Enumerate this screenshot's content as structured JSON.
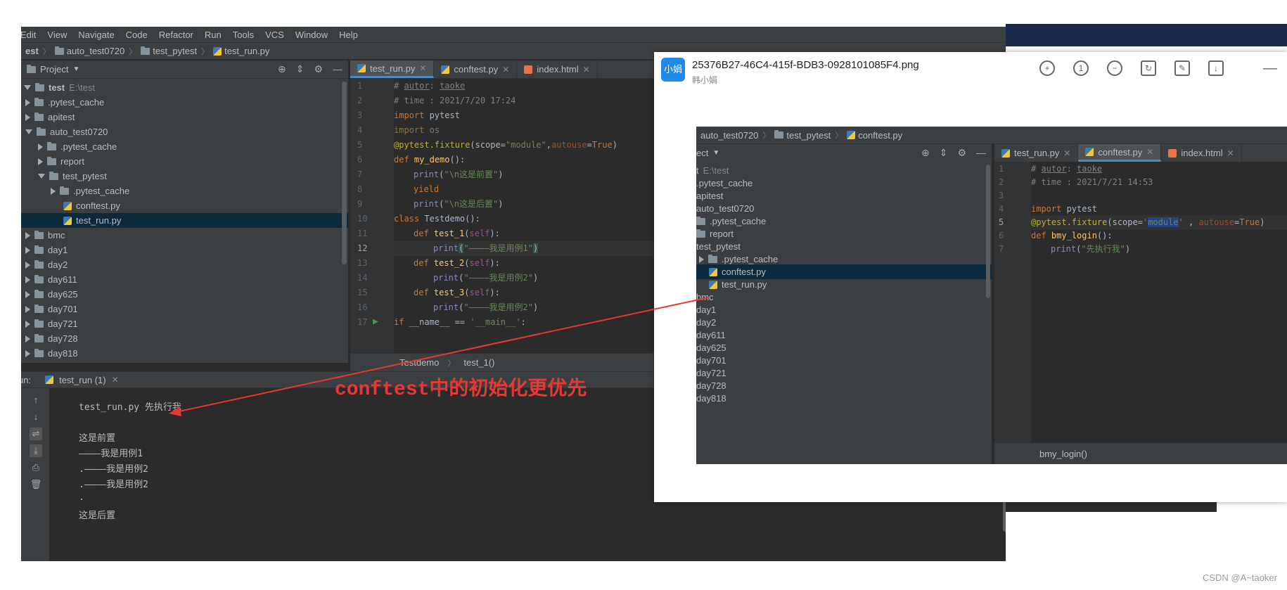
{
  "menu": [
    "Edit",
    "View",
    "Navigate",
    "Code",
    "Refactor",
    "Run",
    "Tools",
    "VCS",
    "Window",
    "Help"
  ],
  "breadcrumb": [
    "est",
    "auto_test0720",
    "test_pytest",
    "test_run.py"
  ],
  "project_panel": {
    "label": "Project"
  },
  "tree": {
    "root": {
      "name": "test",
      "path": "E:\\test"
    },
    "items": [
      {
        "name": ".pytest_cache",
        "level": 1,
        "state": "collapsed"
      },
      {
        "name": "apitest",
        "level": 1,
        "state": "collapsed"
      },
      {
        "name": "auto_test0720",
        "level": 1,
        "state": "expanded"
      },
      {
        "name": ".pytest_cache",
        "level": 2,
        "state": "collapsed"
      },
      {
        "name": "report",
        "level": 2,
        "state": "collapsed"
      },
      {
        "name": "test_pytest",
        "level": 2,
        "state": "expanded"
      },
      {
        "name": ".pytest_cache",
        "level": 3,
        "state": "collapsed"
      },
      {
        "name": "conftest.py",
        "level": 3,
        "state": "file"
      },
      {
        "name": "test_run.py",
        "level": 3,
        "state": "file-selected"
      },
      {
        "name": "bmc",
        "level": 1,
        "state": "collapsed"
      },
      {
        "name": "day1",
        "level": 1,
        "state": "collapsed"
      },
      {
        "name": "day2",
        "level": 1,
        "state": "collapsed"
      },
      {
        "name": "day611",
        "level": 1,
        "state": "collapsed"
      },
      {
        "name": "day625",
        "level": 1,
        "state": "collapsed"
      },
      {
        "name": "day701",
        "level": 1,
        "state": "collapsed"
      },
      {
        "name": "day721",
        "level": 1,
        "state": "collapsed"
      },
      {
        "name": "day728",
        "level": 1,
        "state": "collapsed"
      },
      {
        "name": "day818",
        "level": 1,
        "state": "collapsed"
      }
    ]
  },
  "tabs": [
    "test_run.py",
    "conftest.py",
    "index.html"
  ],
  "editor": {
    "line_numbers": [
      "1",
      "2",
      "3",
      "4",
      "5",
      "6",
      "7",
      "8",
      "9",
      "10",
      "11",
      "12",
      "13",
      "14",
      "15",
      "16",
      "17"
    ],
    "structure": [
      "Testdemo",
      "test_1()"
    ]
  },
  "run": {
    "label": "un:",
    "tab": "test_run (1)",
    "output": [
      "test_run.py 先执行我",
      "",
      "这是前置",
      "————我是用例1",
      ".————我是用例2",
      ".————我是用例2",
      ".",
      "这是后置"
    ]
  },
  "viewer": {
    "logo": "小娟",
    "title": "25376B27-46C4-415f-BDB3-0928101085F4.png",
    "subtitle": "韩小娟",
    "shot": {
      "breadcrumb": [
        "auto_test0720",
        "test_pytest",
        "conftest.py"
      ],
      "panel_label": "ect",
      "tree": [
        {
          "name": "t",
          "path": "E:\\test",
          "indent": 0
        },
        {
          "name": ".pytest_cache",
          "indent": 0
        },
        {
          "name": "apitest",
          "indent": 0
        },
        {
          "name": "auto_test0720",
          "indent": 0
        },
        {
          "name": ".pytest_cache",
          "indent": 1
        },
        {
          "name": "report",
          "indent": 1
        },
        {
          "name": "test_pytest",
          "indent": 0
        },
        {
          "name": ".pytest_cache",
          "indent": 2
        },
        {
          "name": "conftest.py",
          "indent": 2,
          "selected": true
        },
        {
          "name": "test_run.py",
          "indent": 2
        },
        {
          "name": "bmc",
          "indent": 0
        },
        {
          "name": "day1",
          "indent": 0
        },
        {
          "name": "day2",
          "indent": 0
        },
        {
          "name": "day611",
          "indent": 0
        },
        {
          "name": "day625",
          "indent": 0
        },
        {
          "name": "day701",
          "indent": 0
        },
        {
          "name": "day721",
          "indent": 0
        },
        {
          "name": "day728",
          "indent": 0
        },
        {
          "name": "day818",
          "indent": 0
        }
      ],
      "tabs": [
        "test_run.py",
        "conftest.py",
        "index.html"
      ],
      "line_numbers": [
        "1",
        "2",
        "3",
        "4",
        "5",
        "6",
        "7"
      ],
      "structure": "bmy_login()"
    }
  },
  "annotation": "conftest中的初始化更优先",
  "watermark": "CSDN @A~taoker"
}
